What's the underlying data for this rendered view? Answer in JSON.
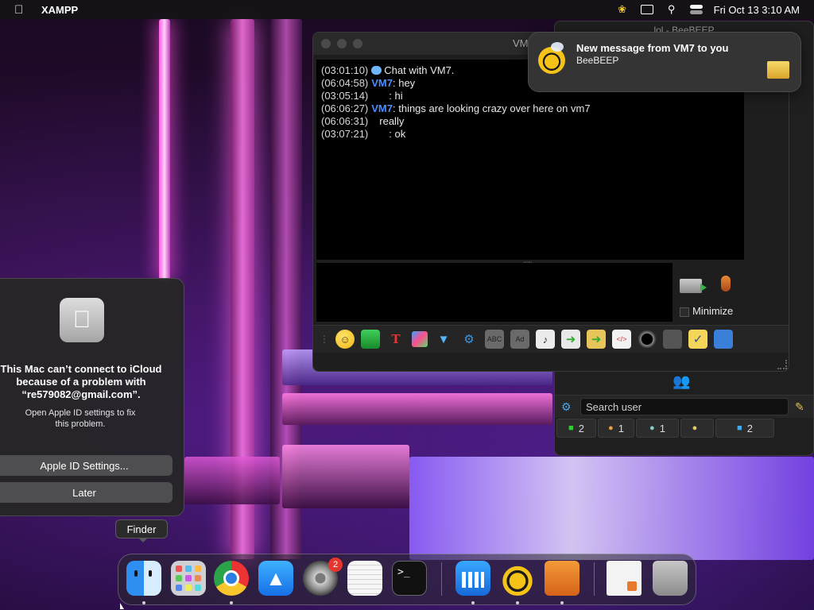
{
  "menubar": {
    "app_name": "XAMPP",
    "datetime": "Fri Oct 13  3:10 AM",
    "icons": [
      "apple-icon",
      "beebeep-icon",
      "screen-mirroring-icon",
      "search-icon",
      "control-center-icon"
    ]
  },
  "beebeep_main": {
    "title": "lol - BeeBEEP",
    "search_placeholder": "Search user",
    "tabs": [
      {
        "icon": "chat-list-icon",
        "count": "2"
      },
      {
        "icon": "users-icon",
        "count": "1"
      },
      {
        "icon": "chat-bubble-icon",
        "count": "1"
      },
      {
        "icon": "groups-icon",
        "count": ""
      },
      {
        "icon": "files-icon",
        "count": "2"
      }
    ]
  },
  "chat_window": {
    "title": "VM7 - BeeBEEP",
    "lines": [
      {
        "time": "(03:01:10)",
        "nick": "",
        "text": "Chat with VM7.",
        "system": true
      },
      {
        "time": "(06:04:58)",
        "nick": "VM7",
        "text": ": hey"
      },
      {
        "time": "(03:05:14)",
        "nick": "",
        "text": ": hi"
      },
      {
        "time": "(06:06:27)",
        "nick": "VM7",
        "text": ": things are looking crazy over here on vm7"
      },
      {
        "time": "(06:06:31)",
        "nick": "",
        "text": "really"
      },
      {
        "time": "(03:07:21)",
        "nick": "",
        "text": ": ok"
      }
    ],
    "minimize_label": "Minimize",
    "toolbar_icons": [
      "emoticon-icon",
      "send-mail-icon",
      "font-icon",
      "color-icon",
      "filter-icon",
      "settings-icon",
      "spellcheck-icon",
      "dictionary-icon",
      "note-icon",
      "send-file-icon",
      "send-folder-icon",
      "code-icon",
      "screenshot-icon",
      "webcam-icon",
      "clipboard-icon",
      "save-icon"
    ]
  },
  "notification": {
    "title": "New message from VM7 to you",
    "body": "BeeBEEP"
  },
  "icloud_dialog": {
    "message_line1": "This Mac can’t connect to iCloud",
    "message_line2": "because of a problem with",
    "message_line3": "“re579082@gmail.com”.",
    "sub_line1": "Open Apple ID settings to fix",
    "sub_line2": "this problem.",
    "primary_button": "Apple ID Settings...",
    "secondary_button": "Later"
  },
  "dock": {
    "tooltip": "Finder",
    "settings_badge": "2",
    "apps": [
      "Finder",
      "Launchpad",
      "Google Chrome",
      "App Store",
      "System Settings",
      "TextEdit",
      "Terminal",
      "Glance",
      "BeeBEEP",
      "XAMPP",
      "Preview",
      "Trash"
    ]
  }
}
